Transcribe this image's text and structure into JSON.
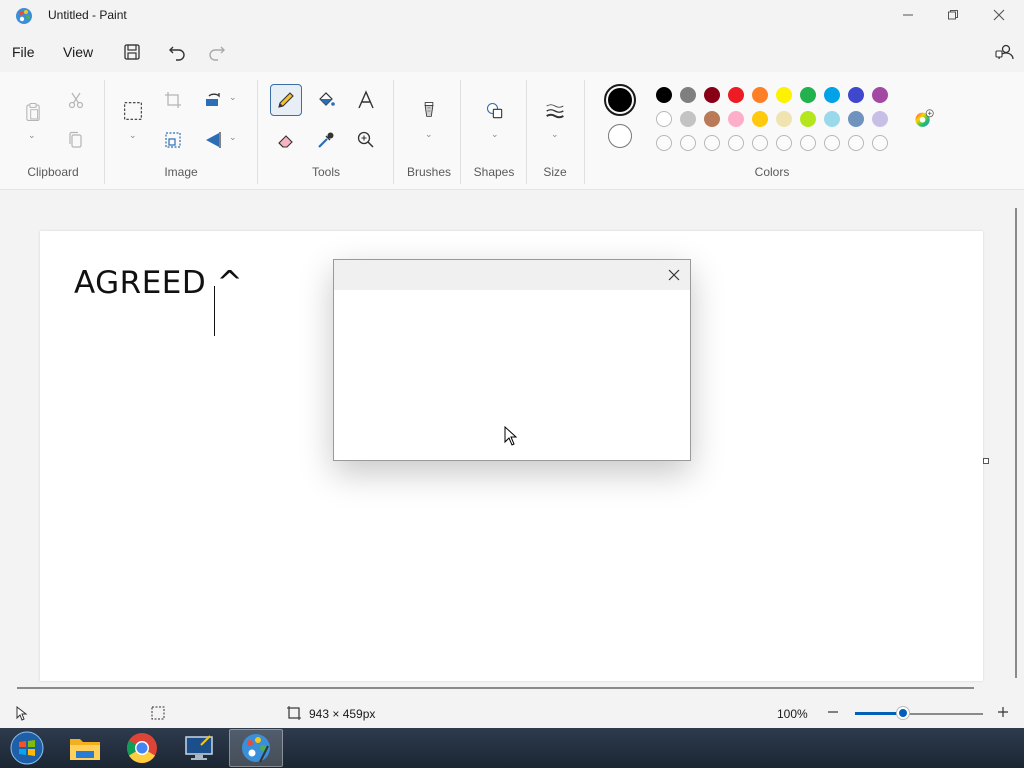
{
  "window": {
    "title": "Untitled - Paint",
    "app_icon": "paint-palette-icon",
    "controls": [
      "minimize-icon",
      "restore-icon",
      "close-icon"
    ]
  },
  "menu": {
    "file_label": "File",
    "view_label": "View",
    "icons": [
      "save-icon",
      "undo-icon",
      "redo-icon",
      "share-icon"
    ]
  },
  "ribbon": {
    "groups": {
      "clipboard": "Clipboard",
      "image": "Image",
      "tools": "Tools",
      "brushes": "Brushes",
      "shapes": "Shapes",
      "size": "Size",
      "colors": "Colors"
    },
    "selected_tool": "pencil",
    "primary_color": "#000000",
    "secondary_color": "#ffffff",
    "palette_row1": [
      "#000000",
      "#7f7f7f",
      "#880015",
      "#ed1c24",
      "#ff7f27",
      "#fff200",
      "#22b14c",
      "#00a2e8",
      "#3f48cc",
      "#a349a4"
    ],
    "palette_row2": [
      "#ffffff",
      "#c3c3c3",
      "#b97a57",
      "#ffaec9",
      "#ffc90e",
      "#efe4b0",
      "#b5e61d",
      "#99d9ea",
      "#7092be",
      "#c8bfe7"
    ],
    "palette_row3_empty_count": 10
  },
  "canvas": {
    "text": "AGREED ^"
  },
  "dialog": {
    "close_icon": "close-icon"
  },
  "status": {
    "canvas_size": "943 × 459px",
    "zoom": "100%",
    "zoom_fraction": 0.375
  },
  "taskbar": {
    "items": [
      "start-orb-icon",
      "file-explorer-icon",
      "chrome-icon",
      "remote-desktop-icon",
      "paint-icon"
    ],
    "active": "paint-icon"
  }
}
